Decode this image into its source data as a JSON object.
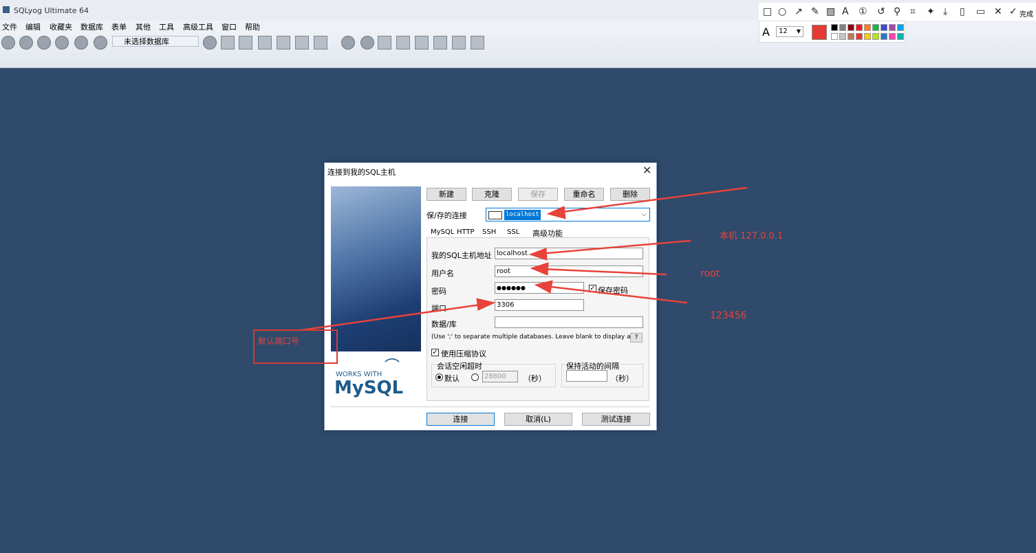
{
  "app": {
    "title": "SQLyog Ultimate 64"
  },
  "menu": [
    "文件",
    "编辑",
    "收藏夹",
    "数据库",
    "表单",
    "其他",
    "工具",
    "高级工具",
    "窗口",
    "帮助"
  ],
  "toolbar": {
    "db_select": "未选择数据库"
  },
  "annot": {
    "font_size": "12",
    "done": "完成",
    "selected_color": "#e53935"
  },
  "dialog": {
    "title": "连接到我的SQL主机",
    "buttons": {
      "new": "新建",
      "clone": "克隆",
      "save": "保存",
      "rename": "重命名",
      "delete": "删除"
    },
    "saved_label": "保/存的连接",
    "saved_value": "localhost",
    "tabs": [
      "MySQL",
      "HTTP",
      "SSH",
      "SSL",
      "高级功能"
    ],
    "host_label": "我的SQL主机地址",
    "host_value": "localhost",
    "user_label": "用户名",
    "user_value": "root",
    "pwd_label": "密码",
    "pwd_value": "●●●●●●",
    "save_pwd": "保存密码",
    "port_label": "端口",
    "port_value": "3306",
    "db_label": "数据/库",
    "db_value": "",
    "db_hint": "(Use ';' to separate multiple databases. Leave blank to display all)",
    "help": "?",
    "compress": "使用压缩协议",
    "session_group": "会话空闲超时",
    "default_label": "默认",
    "timeout_value": "28800",
    "seconds": "（秒）",
    "keepalive_group": "保持活动的间隔",
    "keepalive_value": "",
    "works_with": "WORKS WITH",
    "mysql": "MySQL",
    "connect": "连接",
    "cancel": "取消(L)",
    "test": "测试连接"
  },
  "annotations": {
    "host_note": "本机 127.0.0.1",
    "user_note": "root",
    "pwd_note": "123456",
    "port_note": "默认端口号"
  }
}
